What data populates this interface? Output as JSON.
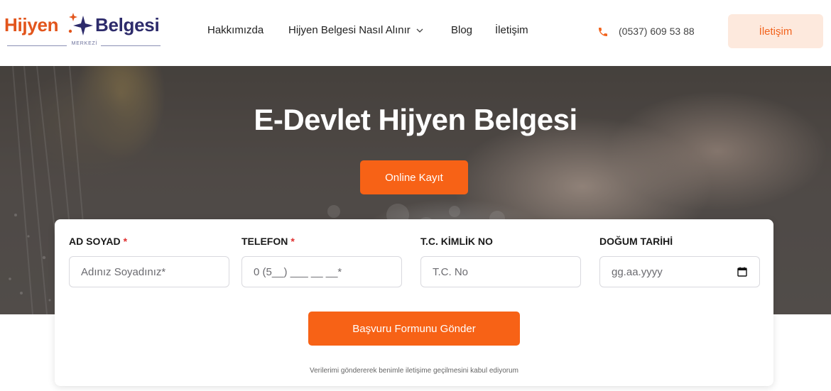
{
  "logo": {
    "left": "Hijyen",
    "right": "Belgesi",
    "sub": "MERKEZİ"
  },
  "nav": {
    "items": [
      {
        "label": "Hakkımızda"
      },
      {
        "label": "Hijyen Belgesi Nasıl Alınır"
      },
      {
        "label": "Blog"
      },
      {
        "label": "İletişim"
      }
    ]
  },
  "header": {
    "phone": "(0537) 609 53 88",
    "contact_button": "İletişim"
  },
  "hero": {
    "title": "E-Devlet Hijyen Belgesi",
    "button": "Online Kayıt"
  },
  "form": {
    "fields": [
      {
        "label": "AD SOYAD",
        "required": "*",
        "placeholder": "Adınız Soyadınız*"
      },
      {
        "label": "TELEFON",
        "required": "*",
        "placeholder": "0 (5__) ___ __ __*"
      },
      {
        "label": "T.C. KİMLİK NO",
        "placeholder": "T.C. No"
      },
      {
        "label": "DOĞUM TARİHİ",
        "placeholder": "gg.aa.yyyy"
      }
    ],
    "submit": "Başvuru Formunu Gönder",
    "consent": "Verilerimi göndererek benimle iletişime geçilmesini kabul ediyorum"
  },
  "colors": {
    "brand_orange": "#f76216",
    "brand_navy": "#2d2b6b",
    "soft_orange": "#fde9dd"
  },
  "icons": [
    "star-sparkle-icon",
    "chevron-down-icon",
    "phone-icon",
    "calendar-icon"
  ]
}
